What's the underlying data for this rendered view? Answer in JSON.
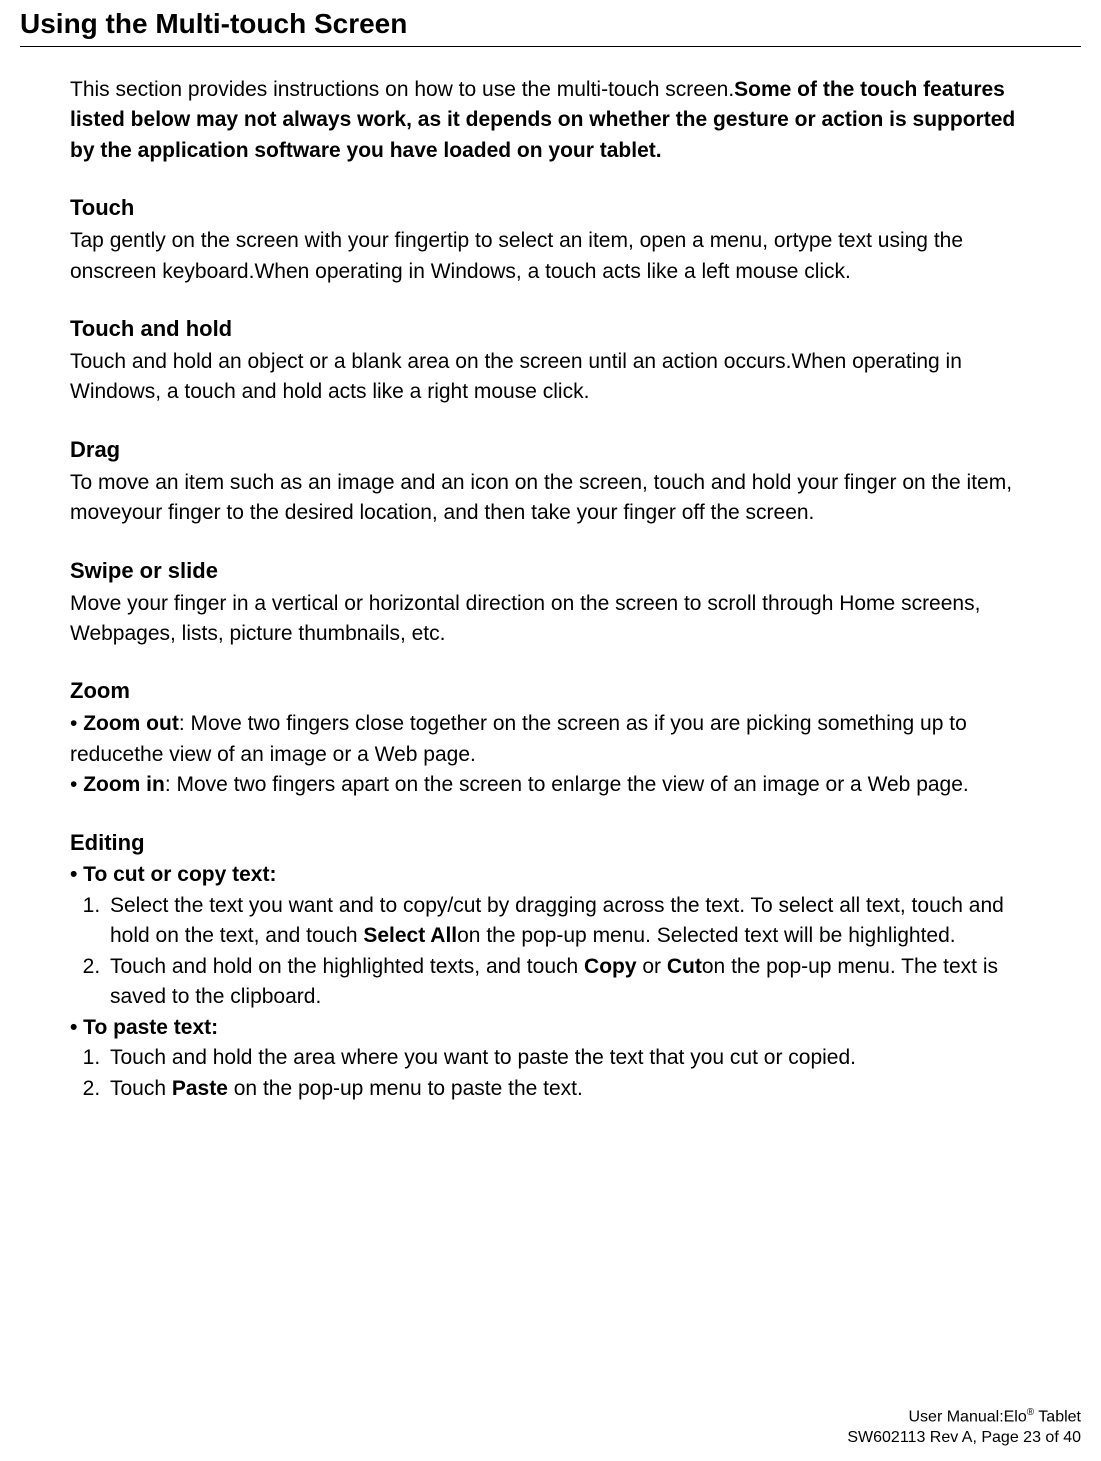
{
  "title": "Using the Multi-touch Screen",
  "intro": {
    "lead": "This section provides instructions on how to use the multi-touch screen.",
    "bold": "Some of the touch features listed below may not always work, as it depends on whether the gesture or action is supported by the application software you have loaded on your tablet."
  },
  "sections": {
    "touch": {
      "heading": "Touch",
      "body": "Tap gently on the screen with your fingertip to select an item, open a menu, ortype text using the onscreen keyboard.When operating in Windows, a touch acts like a left mouse click."
    },
    "touch_hold": {
      "heading": "Touch and hold",
      "body": "Touch and hold an object or a blank area on the screen until an action occurs.When operating in Windows, a touch and hold acts like a right mouse click."
    },
    "drag": {
      "heading": "Drag",
      "body": "To move an item such as an image and an icon on the screen, touch and hold your finger on the item, moveyour finger to the desired location, and then take your finger off the screen."
    },
    "swipe": {
      "heading": "Swipe or slide",
      "body": "Move your finger in a vertical or horizontal direction on the screen to scroll through Home screens, Webpages, lists, picture thumbnails, etc."
    },
    "zoom": {
      "heading": "Zoom",
      "zoom_out_label": "Zoom out",
      "zoom_out_body": ": Move two fingers close together on the screen as if you are picking something up to reducethe view of an image or a Web page.",
      "zoom_in_label": "Zoom in",
      "zoom_in_body": ": Move two fingers apart on the screen to enlarge the view of an image or a Web page."
    },
    "editing": {
      "heading": "Editing",
      "cut_copy_label": "• To cut or copy text:",
      "cut_copy_steps": {
        "s1a": "Select the text you want and to copy/cut by dragging across the text. To select all text, touch and hold on the text, and touch ",
        "s1b": "Select All",
        "s1c": "on the pop-up menu. Selected text will be highlighted.",
        "s2a": "Touch and hold on the highlighted texts, and touch ",
        "s2b": "Copy",
        "s2c": " or ",
        "s2d": "Cut",
        "s2e": "on the pop-up menu. The text is saved to the clipboard."
      },
      "paste_label": "• To paste text:",
      "paste_steps": {
        "p1": "Touch and hold the area where you want to paste the text that you cut or copied.",
        "p2a": "Touch ",
        "p2b": "Paste",
        "p2c": " on the pop-up menu to paste the text."
      }
    }
  },
  "footer": {
    "line1a": "User Manual:Elo",
    "line1b": "®",
    "line1c": " Tablet",
    "line2": "SW602113 Rev A, Page 23 of 40"
  }
}
